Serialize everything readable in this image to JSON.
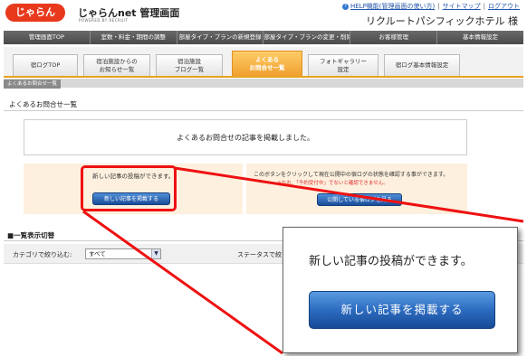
{
  "header": {
    "logo_text": "じゃらん",
    "brand_name": "じゃらんnet 管理画面",
    "brand_sub": "POWERED BY RECRUIT",
    "help_link": "HELP機能(管理画面の使い方)",
    "sitemap_link": "サイトマップ",
    "logout_link": "ログアウト",
    "hotel_name": "リクルートパシフィックホテル 様"
  },
  "main_nav": [
    "管理画面TOP",
    "室数・料金・期間の調整",
    "部屋タイプ・プランの新規登録",
    "部屋タイプ・プランの変更・削除",
    "お客様管理",
    "基本情報設定"
  ],
  "sub_tabs": [
    {
      "label": "宿ログTOP"
    },
    {
      "label": "宿泊施設からの\nお知らせ一覧"
    },
    {
      "label": "宿泊施設\nブログ一覧"
    },
    {
      "label": "よくある\nお問合せ一覧",
      "active": true
    },
    {
      "label": "フォトギャラリー\n設定"
    },
    {
      "label": "宿ログ基本情報設定"
    }
  ],
  "breadcrumb": "よくあるお問合せ一覧",
  "page_title": "よくあるお問合せ一覧",
  "message": "よくあるお問合せの記事を掲載しました。",
  "post_panel": {
    "note": "新しい記事の投稿ができます。",
    "button": "新しい記事を掲載する"
  },
  "status_panel": {
    "text": "このボタンをクリックして現在公開中の宿ログの状態を確認する事ができます。",
    "note": "※なお、「予約受付中」でないと確認できません。",
    "button": "公開している宿ログを見る"
  },
  "list_section": {
    "title": "■一覧表示切替",
    "category_label": "カテゴリで絞り込む:",
    "category_value": "すべて",
    "status_label": "ステータスで絞"
  },
  "zoom": {
    "text": "新しい記事の投稿ができます。",
    "button": "新しい記事を掲載する"
  },
  "colors": {
    "accent_orange": "#f0a030",
    "highlight_red": "#ee1111",
    "button_blue": "#2d6cc0",
    "panel_bg": "#fdf0de"
  }
}
